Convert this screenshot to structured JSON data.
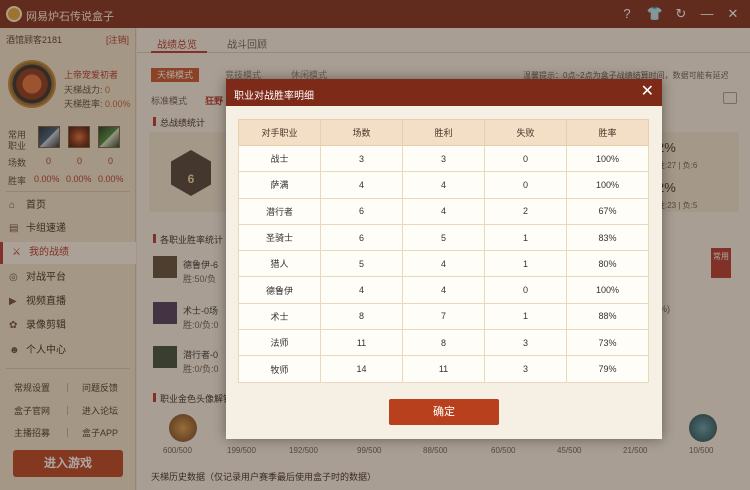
{
  "app": {
    "title": "网易炉石传说盒子"
  },
  "window_controls": [
    "?",
    "👕",
    "↻",
    "—",
    "✕"
  ],
  "sidebar": {
    "user": "酒馆顾客2181",
    "logout": "[注销]",
    "name": "上帝宠爱初者",
    "stats": [
      {
        "label": "天梯战力: ",
        "value": "0"
      },
      {
        "label": "天梯胜率: ",
        "value": "0.00%"
      }
    ],
    "common_label": "常用\n职业",
    "rows": [
      {
        "label": "场数",
        "values": [
          "0",
          "0",
          "0"
        ]
      },
      {
        "label": "胜率",
        "values": [
          "0.00%",
          "0.00%",
          "0.00%"
        ]
      }
    ],
    "nav": [
      {
        "icon": "⌂",
        "label": "首页",
        "active": false
      },
      {
        "icon": "▤",
        "label": "卡组速递",
        "active": false
      },
      {
        "icon": "⚔",
        "label": "我的战绩",
        "active": true
      },
      {
        "icon": "◎",
        "label": "对战平台",
        "active": false
      },
      {
        "icon": "▶",
        "label": "视频直播",
        "active": false
      },
      {
        "icon": "✿",
        "label": "录像剪辑",
        "active": false
      },
      {
        "icon": "☻",
        "label": "个人中心",
        "active": false
      }
    ],
    "links": [
      [
        "常规设置",
        "问题反馈"
      ],
      [
        "盒子官网",
        "进入论坛"
      ],
      [
        "主播招募",
        "盒子APP"
      ]
    ],
    "play_button": "进入游戏"
  },
  "main": {
    "tabs": [
      "战绩总览",
      "战斗回顾"
    ],
    "modes": [
      "天梯模式",
      "竞技模式",
      "休闲模式"
    ],
    "hint": "温馨提示：0点~2点为盒子战绩结算时间，数据可能有延迟",
    "sub_modes": [
      "标准模式",
      "狂野"
    ],
    "section_overall": "总战绩统计",
    "rank": "6",
    "overall_right": [
      {
        "pct": "2%",
        "detail": "胜:27 | 负:6"
      },
      {
        "pct": "2%",
        "detail": "胜:23 | 负:5"
      }
    ],
    "section_class": "各职业胜率统计",
    "class_rows": [
      {
        "name": "德鲁伊-6",
        "detail": "胜:50/负"
      },
      {
        "name": "术士-0场",
        "detail": "胜:0/负:0"
      },
      {
        "name": "潜行者-0",
        "detail": "胜:0/负:0"
      }
    ],
    "common_tag": "常用",
    "pct_tail": "%)",
    "section_golden": "职业金色头像解锁",
    "golden": [
      "600/500",
      "199/500",
      "192/500",
      "99/500",
      "88/500",
      "60/500",
      "45/500",
      "21/500",
      "10/500"
    ],
    "footer": "天梯历史数据（仅记录用户赛季最后使用盒子时的数据）"
  },
  "dialog": {
    "title": "职业对战胜率明细",
    "close": "✕",
    "headers": [
      "对手职业",
      "场数",
      "胜利",
      "失败",
      "胜率"
    ],
    "rows": [
      [
        "战士",
        "3",
        "3",
        "0",
        "100%"
      ],
      [
        "萨满",
        "4",
        "4",
        "0",
        "100%"
      ],
      [
        "潜行者",
        "6",
        "4",
        "2",
        "67%"
      ],
      [
        "圣骑士",
        "6",
        "5",
        "1",
        "83%"
      ],
      [
        "猎人",
        "5",
        "4",
        "1",
        "80%"
      ],
      [
        "德鲁伊",
        "4",
        "4",
        "0",
        "100%"
      ],
      [
        "术士",
        "8",
        "7",
        "1",
        "88%"
      ],
      [
        "法师",
        "11",
        "8",
        "3",
        "73%"
      ],
      [
        "牧师",
        "14",
        "11",
        "3",
        "79%"
      ]
    ],
    "ok": "确定"
  }
}
